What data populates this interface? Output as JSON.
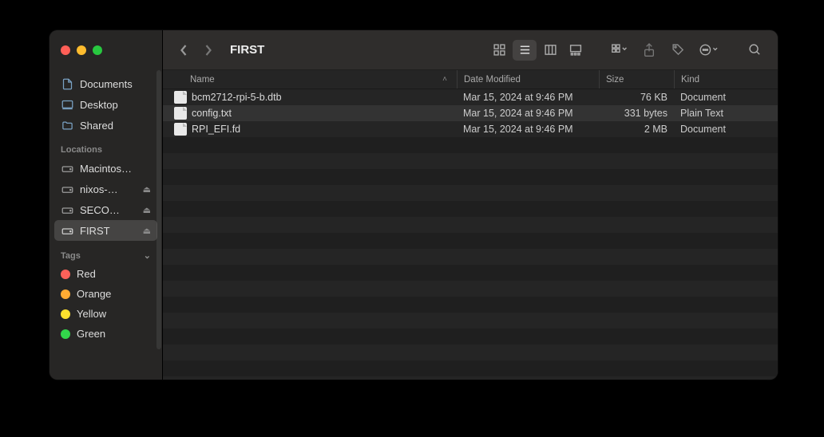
{
  "window": {
    "title": "FIRST"
  },
  "sidebar": {
    "favorites": [
      {
        "icon": "document-icon",
        "label": "Documents"
      },
      {
        "icon": "desktop-icon",
        "label": "Desktop"
      },
      {
        "icon": "folder-icon",
        "label": "Shared"
      }
    ],
    "locations_header": "Locations",
    "locations": [
      {
        "label": "Macintos…",
        "eject": false
      },
      {
        "label": "nixos-…",
        "eject": true
      },
      {
        "label": "SECO…",
        "eject": true
      },
      {
        "label": "FIRST",
        "eject": true,
        "selected": true
      }
    ],
    "tags_header": "Tags",
    "tags": [
      {
        "label": "Red",
        "color": "#ff6159"
      },
      {
        "label": "Orange",
        "color": "#ffab33"
      },
      {
        "label": "Yellow",
        "color": "#ffe12e"
      },
      {
        "label": "Green",
        "color": "#32d74b"
      }
    ]
  },
  "columns": {
    "name": "Name",
    "date": "Date Modified",
    "size": "Size",
    "kind": "Kind",
    "sort": "name-asc"
  },
  "files": [
    {
      "name": "bcm2712-rpi-5-b.dtb",
      "date": "Mar 15, 2024 at 9:46 PM",
      "size": "76 KB",
      "kind": "Document",
      "selected": false
    },
    {
      "name": "config.txt",
      "date": "Mar 15, 2024 at 9:46 PM",
      "size": "331 bytes",
      "kind": "Plain Text",
      "selected": true
    },
    {
      "name": "RPI_EFI.fd",
      "date": "Mar 15, 2024 at 9:46 PM",
      "size": "2 MB",
      "kind": "Document",
      "selected": false
    }
  ],
  "toolbar": {
    "view_mode": "list",
    "icons": {
      "back": "chevron-left-icon",
      "forward": "chevron-right-icon",
      "icon_view": "grid-icon",
      "list_view": "list-icon",
      "column_view": "columns-icon",
      "gallery_view": "gallery-icon",
      "group": "group-icon",
      "share": "share-icon",
      "tag": "tag-icon",
      "action": "ellipsis-circle-icon",
      "search": "search-icon"
    }
  }
}
